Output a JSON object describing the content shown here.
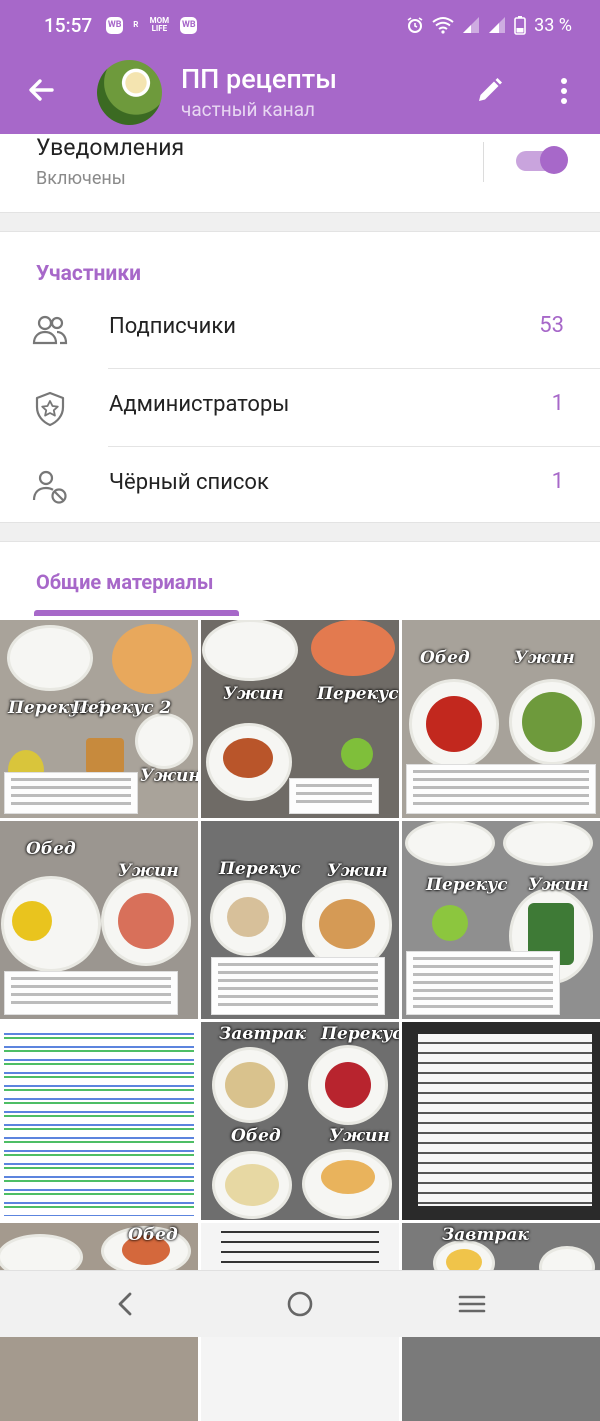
{
  "status_bar": {
    "time": "15:57",
    "left_icons": [
      "WB",
      "R",
      "MOM LIFE",
      "WB"
    ],
    "right_icons": [
      "alarm-icon",
      "wifi-icon",
      "signal-icon",
      "signal-icon",
      "battery-icon"
    ],
    "battery": "33 %"
  },
  "appbar": {
    "title": "ПП рецепты",
    "subtitle": "частный канал",
    "back_icon": "arrow-left-icon",
    "edit_icon": "pencil-icon",
    "menu_icon": "more-vertical-icon"
  },
  "notifications": {
    "title": "Уведомления",
    "status": "Включены",
    "enabled": true
  },
  "members": {
    "section_title": "Участники",
    "rows": [
      {
        "label": "Подписчики",
        "count": "53",
        "icon": "users-icon"
      },
      {
        "label": "Администраторы",
        "count": "1",
        "icon": "admin-shield-icon"
      },
      {
        "label": "Чёрный список",
        "count": "1",
        "icon": "user-blocked-icon"
      }
    ]
  },
  "media": {
    "tab_label": "Общие материалы",
    "tiles": [
      {
        "captions": [
          "Перекус 1",
          "Перекус 2",
          "Ужин"
        ],
        "bg": "#a9a39a"
      },
      {
        "captions": [
          "Ужин",
          "Перекус"
        ],
        "bg": "#6f6b66"
      },
      {
        "captions": [
          "Обед",
          "Ужин"
        ],
        "bg": "#a7a29a"
      },
      {
        "captions": [
          "Обед",
          "Ужин"
        ],
        "bg": "#9b9690"
      },
      {
        "captions": [
          "Перекус",
          "Ужин"
        ],
        "bg": "#707070"
      },
      {
        "captions": [
          "Перекус",
          "Ужин"
        ],
        "bg": "#8f8f8f"
      },
      {
        "captions": [],
        "bg": "#5a74c8"
      },
      {
        "captions": [
          "Завтрак",
          "Перекус",
          "Обед",
          "Ужин"
        ],
        "bg": "#6e6e6e"
      },
      {
        "captions": [],
        "bg": "#2a2a2a"
      },
      {
        "captions": [
          "Обед"
        ],
        "bg": "#a49a8e"
      },
      {
        "captions": [],
        "bg": "#f4f4f4"
      },
      {
        "captions": [
          "Завтрак"
        ],
        "bg": "#7a7a7a"
      }
    ]
  },
  "colors": {
    "accent": "#a768c9",
    "accent_light": "#c9a4dd",
    "divider": "#e4e4e4"
  },
  "navbar": {
    "buttons": [
      "back-nav-icon",
      "home-nav-icon",
      "recents-nav-icon"
    ]
  }
}
